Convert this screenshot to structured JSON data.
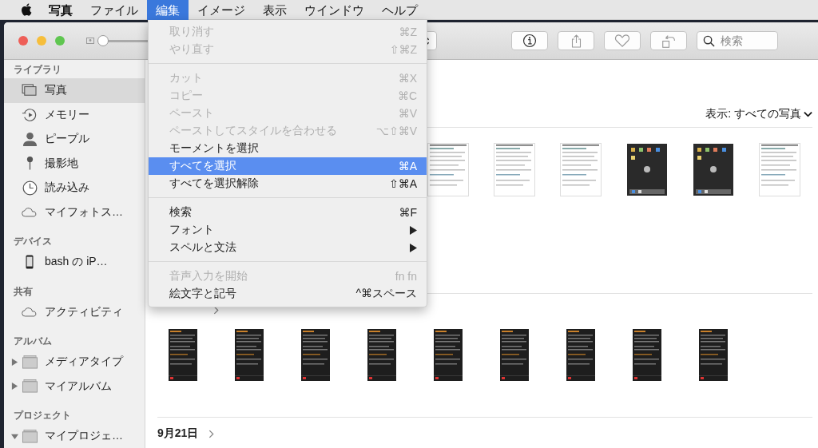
{
  "menubar": {
    "items": [
      {
        "label": "写真",
        "selected": false
      },
      {
        "label": "ファイル",
        "selected": false
      },
      {
        "label": "編集",
        "selected": true
      },
      {
        "label": "イメージ",
        "selected": false
      },
      {
        "label": "表示",
        "selected": false
      },
      {
        "label": "ウインドウ",
        "selected": false
      },
      {
        "label": "ヘルプ",
        "selected": false
      }
    ]
  },
  "edit_menu": {
    "items": [
      {
        "kind": "item",
        "label": "取り消す",
        "shortcut": "⌘Z",
        "disabled": true,
        "selected": false
      },
      {
        "kind": "item",
        "label": "やり直す",
        "shortcut": "⇧⌘Z",
        "disabled": true,
        "selected": false
      },
      {
        "kind": "separator"
      },
      {
        "kind": "item",
        "label": "カット",
        "shortcut": "⌘X",
        "disabled": true,
        "selected": false
      },
      {
        "kind": "item",
        "label": "コピー",
        "shortcut": "⌘C",
        "disabled": true,
        "selected": false
      },
      {
        "kind": "item",
        "label": "ペースト",
        "shortcut": "⌘V",
        "disabled": true,
        "selected": false
      },
      {
        "kind": "item",
        "label": "ペーストしてスタイルを合わせる",
        "shortcut": "⌥⇧⌘V",
        "disabled": true,
        "selected": false
      },
      {
        "kind": "item",
        "label": "モーメントを選択",
        "disabled": false,
        "selected": false
      },
      {
        "kind": "item",
        "label": "すべてを選択",
        "shortcut": "⌘A",
        "disabled": false,
        "selected": true
      },
      {
        "kind": "item",
        "label": "すべてを選択解除",
        "shortcut": "⇧⌘A",
        "disabled": false,
        "selected": false
      },
      {
        "kind": "separator"
      },
      {
        "kind": "item",
        "label": "検索",
        "shortcut": "⌘F",
        "disabled": false,
        "selected": false
      },
      {
        "kind": "item",
        "label": "フォント",
        "submenu": true,
        "disabled": false,
        "selected": false
      },
      {
        "kind": "item",
        "label": "スペルと文法",
        "submenu": true,
        "disabled": false,
        "selected": false
      },
      {
        "kind": "separator"
      },
      {
        "kind": "item",
        "label": "音声入力を開始",
        "shortcut": "fn fn",
        "disabled": true,
        "selected": false
      },
      {
        "kind": "item",
        "label": "絵文字と記号",
        "shortcut": "^⌘スペース",
        "disabled": false,
        "selected": false
      }
    ]
  },
  "toolbar": {
    "zoom_slider": {
      "level": 0
    },
    "search": {
      "placeholder": "検索"
    }
  },
  "sidebar": {
    "sections": [
      {
        "title": "ライブラリ",
        "items": [
          {
            "label": "写真",
            "selected": true
          },
          {
            "label": "メモリー",
            "selected": false
          },
          {
            "label": "ピープル",
            "selected": false
          },
          {
            "label": "撮影地",
            "selected": false
          },
          {
            "label": "読み込み",
            "selected": false
          },
          {
            "label": "マイフォトス…",
            "selected": false
          }
        ]
      },
      {
        "title": "デバイス",
        "items": [
          {
            "label": "bash の iP…",
            "selected": false
          }
        ]
      },
      {
        "title": "共有",
        "items": [
          {
            "label": "アクティビティ",
            "selected": false
          }
        ]
      },
      {
        "title": "アルバム",
        "items": [
          {
            "label": "メディアタイプ",
            "selected": false,
            "expanded": false
          },
          {
            "label": "マイアルバム",
            "selected": false,
            "expanded": false
          }
        ]
      },
      {
        "title": "プロジェクト",
        "items": [
          {
            "label": "マイプロジェ…",
            "selected": false,
            "expanded": true
          }
        ]
      }
    ]
  },
  "content": {
    "filter": {
      "label": "表示: すべての写真"
    },
    "groups": [
      {
        "thumbnails": [
          {
            "kind": "picture"
          },
          {
            "kind": "picture"
          },
          {
            "kind": "picture"
          },
          {
            "kind": "picture"
          },
          {
            "kind": "picture"
          },
          {
            "kind": "picture"
          }
        ]
      },
      {
        "thumbnails": [
          {
            "kind": "picture"
          },
          {
            "kind": "picture"
          },
          {
            "kind": "picture"
          },
          {
            "kind": "picture"
          },
          {
            "kind": "picture"
          },
          {
            "kind": "picture"
          },
          {
            "kind": "picture"
          },
          {
            "kind": "picture"
          },
          {
            "kind": "picture"
          }
        ]
      },
      {
        "date": "9月21日"
      }
    ]
  }
}
